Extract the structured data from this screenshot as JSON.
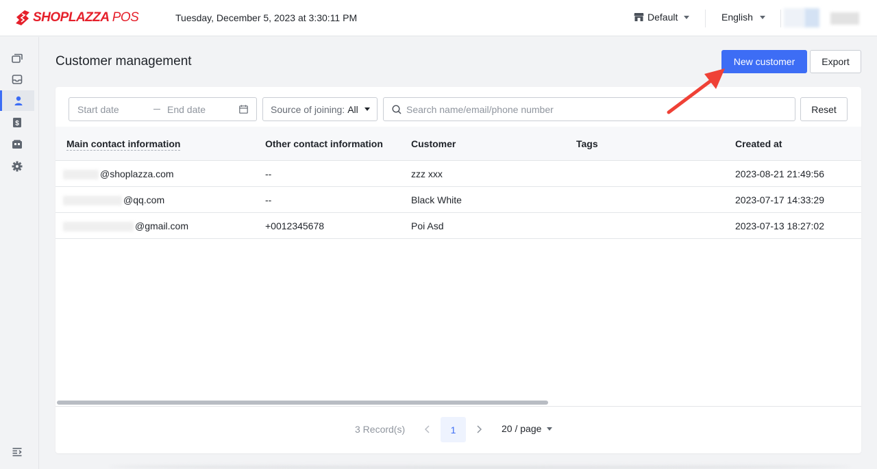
{
  "header": {
    "logo_text": "SHOPLAZZA",
    "logo_suffix": "POS",
    "datetime": "Tuesday, December 5, 2023 at 3:30:11 PM",
    "store_label": "Default",
    "language_label": "English"
  },
  "sidebar": {
    "items": [
      {
        "icon": "cards-icon",
        "active": false
      },
      {
        "icon": "inbox-icon",
        "active": false
      },
      {
        "icon": "person-icon",
        "active": true
      },
      {
        "icon": "dollar-icon",
        "active": false
      },
      {
        "icon": "wallet-icon",
        "active": false
      },
      {
        "icon": "gear-icon",
        "active": false
      }
    ],
    "collapse_icon": "collapse-menu-icon"
  },
  "page": {
    "title": "Customer management",
    "new_customer_label": "New customer",
    "export_label": "Export"
  },
  "filters": {
    "start_date_placeholder": "Start date",
    "end_date_placeholder": "End date",
    "source_label": "Source of joining:",
    "source_value": "All",
    "search_placeholder": "Search name/email/phone number",
    "reset_label": "Reset"
  },
  "table": {
    "columns": [
      "Main contact information",
      "Other contact information",
      "Customer",
      "Tags",
      "Created at"
    ],
    "rows": [
      {
        "main_contact": "@shoplazza.com",
        "other_contact": "--",
        "customer": "zzz xxx",
        "tags": "",
        "created_at": "2023-08-21 21:49:56"
      },
      {
        "main_contact": "@qq.com",
        "other_contact": "--",
        "customer": "Black White",
        "tags": "",
        "created_at": "2023-07-17 14:33:29"
      },
      {
        "main_contact": "@gmail.com",
        "other_contact": "+0012345678",
        "customer": "Poi Asd",
        "tags": "",
        "created_at": "2023-07-13 18:27:02"
      }
    ]
  },
  "pagination": {
    "records": "3 Record(s)",
    "current_page": "1",
    "page_size": "20 / page"
  },
  "colors": {
    "accent": "#3d6df5",
    "brand": "#e5202b",
    "annotation_arrow": "#ef4136"
  }
}
